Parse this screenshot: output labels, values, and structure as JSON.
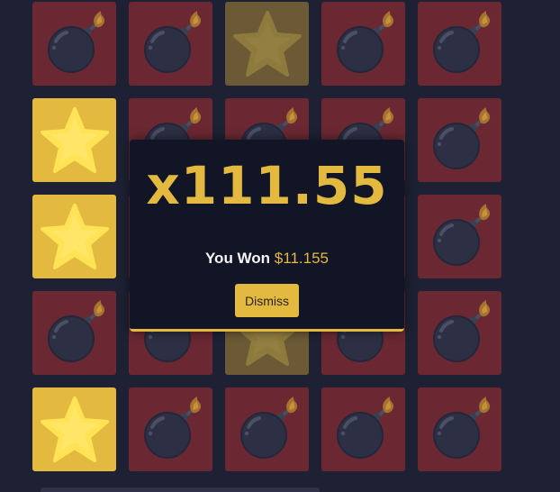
{
  "modal": {
    "multiplier": "x111.55",
    "won_label": "You Won",
    "won_amount": "$11.155",
    "dismiss_label": "Dismiss"
  },
  "colors": {
    "background": "#1e2134",
    "bomb_tile": "#6b2832",
    "star_tile": "#e3b93f",
    "star_tile_revealed_dim": "#6b5a35",
    "accent": "#e3b93f",
    "modal": "#121526"
  },
  "board": {
    "rows": 5,
    "cols": 5,
    "tiles": [
      [
        "bomb",
        "bomb",
        "star-dim",
        "bomb",
        "bomb"
      ],
      [
        "star",
        "bomb",
        "bomb",
        "bomb",
        "bomb"
      ],
      [
        "star",
        "bomb",
        "star-dim",
        "bomb",
        "bomb"
      ],
      [
        "bomb",
        "bomb",
        "star-dim",
        "bomb",
        "bomb"
      ],
      [
        "star",
        "bomb",
        "bomb",
        "bomb",
        "bomb"
      ]
    ],
    "icons": {
      "bomb": "bomb-icon",
      "star": "star-icon",
      "star-dim": "star-icon"
    }
  }
}
